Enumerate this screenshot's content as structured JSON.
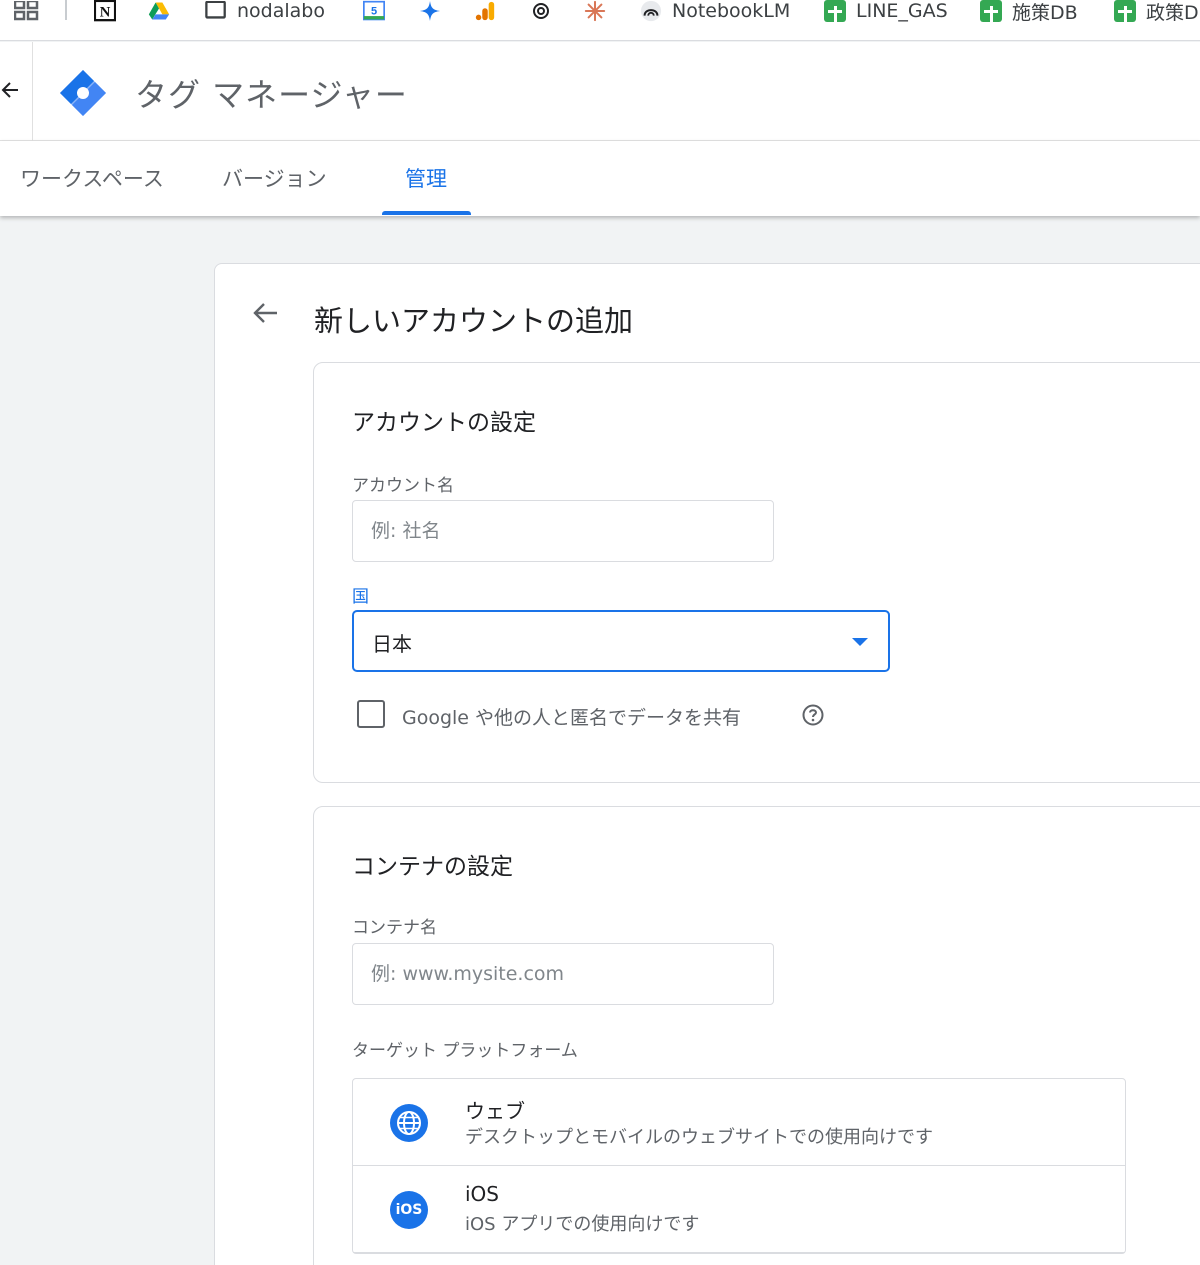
{
  "bookmarks": {
    "items": [
      {
        "label": "nodalabo",
        "icon": "folder-icon"
      },
      {
        "label": "NotebookLM",
        "icon": "notebooklm-icon"
      },
      {
        "label": "LINE_GAS",
        "icon": "sheets-icon"
      },
      {
        "label": "施策DB",
        "icon": "sheets-icon"
      },
      {
        "label": "政策D",
        "icon": "sheets-icon"
      }
    ],
    "calendar_day": "5"
  },
  "header": {
    "app_title": "タグ マネージャー",
    "back_icon": "arrow-back-icon",
    "logo_icon": "tag-manager-logo-icon"
  },
  "tabs": [
    {
      "label": "ワークスペース",
      "active": false
    },
    {
      "label": "バージョン",
      "active": false
    },
    {
      "label": "管理",
      "active": true
    }
  ],
  "page": {
    "title": "新しいアカウントの追加"
  },
  "account_settings": {
    "title": "アカウントの設定",
    "account_name_label": "アカウント名",
    "account_name_placeholder": "例: 社名",
    "account_name_value": "",
    "country_label": "国",
    "country_value": "日本",
    "share_data_label": "Google や他の人と匿名でデータを共有",
    "share_data_checked": false
  },
  "container_settings": {
    "title": "コンテナの設定",
    "container_name_label": "コンテナ名",
    "container_name_placeholder": "例: www.mysite.com",
    "container_name_value": "",
    "platform_label": "ターゲット プラットフォーム",
    "platforms": [
      {
        "name": "ウェブ",
        "description": "デスクトップとモバイルのウェブサイトでの使用向けです",
        "icon": "globe-icon"
      },
      {
        "name": "iOS",
        "description": "iOS アプリでの使用向けです",
        "icon": "ios-icon",
        "icon_text": "iOS"
      }
    ]
  },
  "colors": {
    "accent": "#1a73e8",
    "background": "#f1f3f4",
    "sheets_green": "#34a853"
  }
}
